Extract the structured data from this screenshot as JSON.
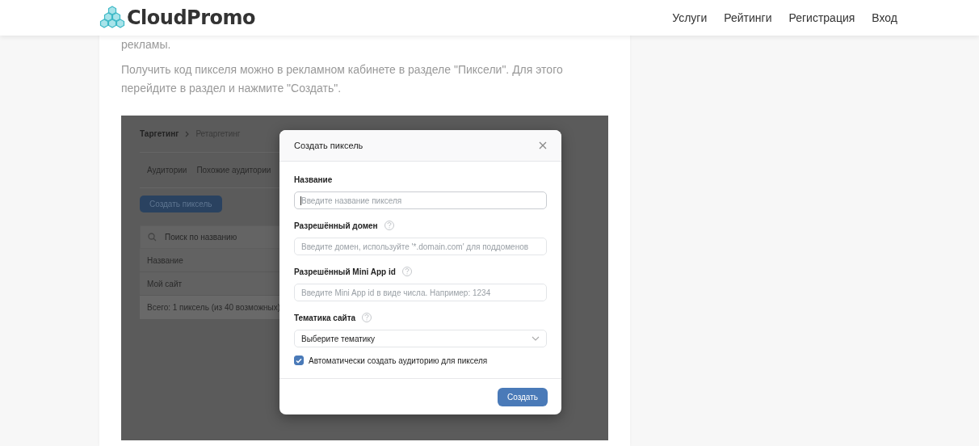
{
  "header": {
    "logo": "CloudPromo",
    "nav": [
      "Услуги",
      "Рейтинги",
      "Регистрация",
      "Вход"
    ]
  },
  "article": {
    "paragraphs": [
      "рекламы.",
      "Получить код пикселя можно в рекламном кабинете в разделе \"Пиксели\". Для этого перейдите в раздел и нажмите \"Создать\"."
    ]
  },
  "screenshot": {
    "background": {
      "breadcrumb": [
        "Таргетинг",
        "Ретаргетинг"
      ],
      "tabs": [
        "Аудитории",
        "Похожие аудитории"
      ],
      "create_button": "Создать пиксель",
      "search_placeholder": "Поиск по названию",
      "column": "Название",
      "row": "Мой сайт",
      "total": "Всего: 1 пиксель (из 40 возможных)"
    },
    "dialog": {
      "title": "Создать пиксель",
      "fields": [
        {
          "kind": "text",
          "label": "Название",
          "help": false,
          "focused": true,
          "placeholder": "Введите название пикселя"
        },
        {
          "kind": "text",
          "label": "Разрешённый домен",
          "help": true,
          "focused": false,
          "placeholder": "Введите домен, используйте '*.domain.com' для поддоменов"
        },
        {
          "kind": "text",
          "label": "Разрешённый Mini App id",
          "help": true,
          "focused": false,
          "placeholder": "Введите Mini App id в виде числа. Например: 1234"
        },
        {
          "kind": "select",
          "label": "Тематика сайта",
          "help": true,
          "value": "Выберите тематику"
        }
      ],
      "checkbox": {
        "label": "Автоматически создать аудиторию для пикселя",
        "checked": true
      },
      "submit": "Создать"
    }
  }
}
